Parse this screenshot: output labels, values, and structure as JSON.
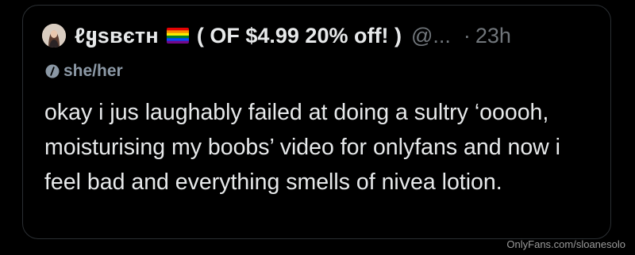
{
  "post": {
    "display_name": "ℓყѕвєтн",
    "flag_icon": "rainbow-flag-icon",
    "promo": "( OF $4.99 20% off! )",
    "handle": "@...",
    "separator": "·",
    "time": "23h",
    "pronouns_icon": "pronouns-icon",
    "pronouns": "she/her",
    "body": "okay i jus laughably failed at doing a sultry ‘ooooh, moisturising my boobs’ video for onlyfans and now i feel bad and everything smells of nivea lotion."
  },
  "watermark": "OnlyFans.com/sloanesolo",
  "colors": {
    "background": "#000000",
    "text": "#e7e9ea",
    "muted": "#71767b",
    "pronouns": "#8b98a5",
    "border": "#2b2f33"
  }
}
